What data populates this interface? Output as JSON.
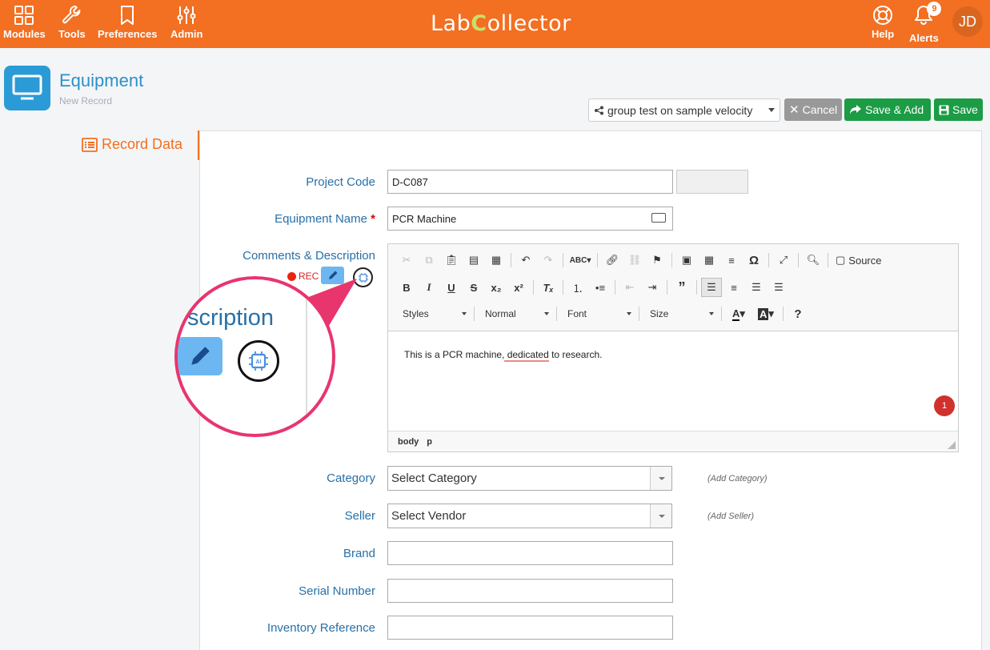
{
  "topbar": {
    "nav": [
      {
        "label": "Modules",
        "icon": "grid-icon"
      },
      {
        "label": "Tools",
        "icon": "wrench-icon"
      },
      {
        "label": "Preferences",
        "icon": "bookmark-icon"
      },
      {
        "label": "Admin",
        "icon": "sliders-icon"
      }
    ],
    "logo": {
      "pre": "Lab",
      "c": "C",
      "post": "ollector"
    },
    "help_label": "Help",
    "alerts_label": "Alerts",
    "alerts_count": "9",
    "avatar_initials": "JD",
    "bg_color": "#f36f21"
  },
  "header": {
    "title": "Equipment",
    "subtitle": "New Record"
  },
  "actions": {
    "group_value": "group test on sample velocity",
    "cancel_label": "Cancel",
    "save_add_label": "Save & Add",
    "save_label": "Save"
  },
  "side_tab": {
    "label": "Record Data"
  },
  "form": {
    "project_code": {
      "label": "Project Code",
      "value": "D-C087"
    },
    "equipment_name": {
      "label": "Equipment Name",
      "value": "PCR Machine"
    },
    "comments": {
      "label": "Comments & Description",
      "rec_label": "REC",
      "content_pre": "This is a PCR machine,",
      "content_spell": " dedicated",
      "content_post": " to research.",
      "badge_count": "1",
      "path": [
        "body",
        "p"
      ],
      "toolbar": {
        "source_label": "Source",
        "styles_label": "Styles",
        "format_label": "Normal",
        "font_label": "Font",
        "size_label": "Size"
      }
    },
    "category": {
      "label": "Category",
      "value": "Select Category",
      "add_label": "(Add Category)"
    },
    "seller": {
      "label": "Seller",
      "value": "Select Vendor",
      "add_label": "(Add Seller)"
    },
    "brand": {
      "label": "Brand",
      "value": ""
    },
    "serial_number": {
      "label": "Serial Number",
      "value": ""
    },
    "inventory_reference": {
      "label": "Inventory Reference",
      "value": ""
    }
  },
  "magnifier": {
    "text": "scription"
  }
}
